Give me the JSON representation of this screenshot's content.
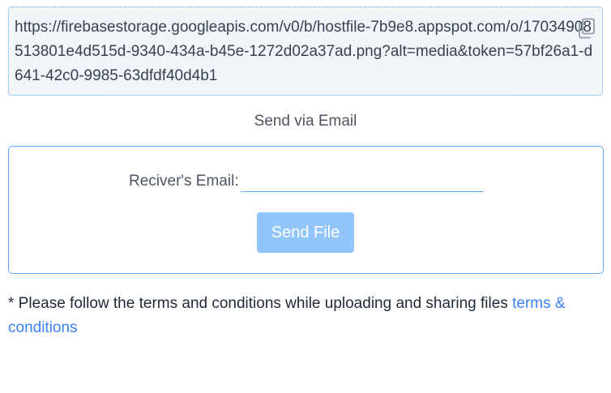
{
  "share": {
    "url": "https://firebasestorage.googleapis.com/v0/b/hostfile-7b9e8.appspot.com/o/17034908513801e4d515d-9340-434a-b45e-1272d02a37ad.png?alt=media&token=57bf26a1-d641-42c0-9985-63dfdf40d4b1",
    "copy_icon": "copy-icon"
  },
  "email": {
    "heading": "Send via Email",
    "label": "Reciver's Email:",
    "input_value": "",
    "send_label": "Send File"
  },
  "terms": {
    "text": "* Please follow the terms and conditions while uploading and sharing files ",
    "link_label": "terms & conditions"
  },
  "colors": {
    "accent": "#60a5fa",
    "button_bg": "#93c5fd",
    "link": "#3b82f6",
    "url_box_bg": "#f1f5f9"
  }
}
